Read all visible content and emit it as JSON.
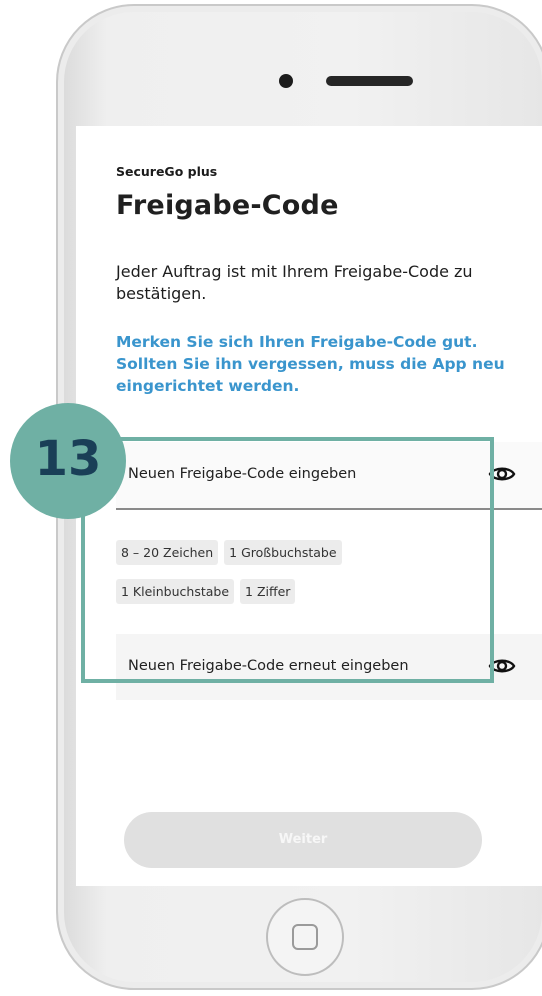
{
  "app": {
    "name": "SecureGo plus"
  },
  "page": {
    "title": "Freigabe-Code",
    "intro": "Jeder Auftrag ist mit Ihrem Freigabe-Code zu bestätigen.",
    "warning": "Merken Sie sich Ihren Freigabe-Code gut. Sollten Sie ihn vergessen, muss die App neu eingerichtet werden."
  },
  "form": {
    "new_code_placeholder": "Neuen Freigabe-Code eingeben",
    "repeat_code_placeholder": "Neuen Freigabe-Code erneut eingeben",
    "requirements": [
      "8 – 20 Zeichen",
      "1 Großbuchstabe",
      "1 Kleinbuchstabe",
      "1 Ziffer"
    ],
    "show_icon": "eye-icon"
  },
  "actions": {
    "next_label": "Weiter"
  },
  "annotation": {
    "step_number": "13"
  },
  "colors": {
    "accent_blue": "#3a95cd",
    "highlight_teal": "#6fb0a4",
    "badge_text": "#1a3f57",
    "button_disabled": "#e0e0e0"
  }
}
